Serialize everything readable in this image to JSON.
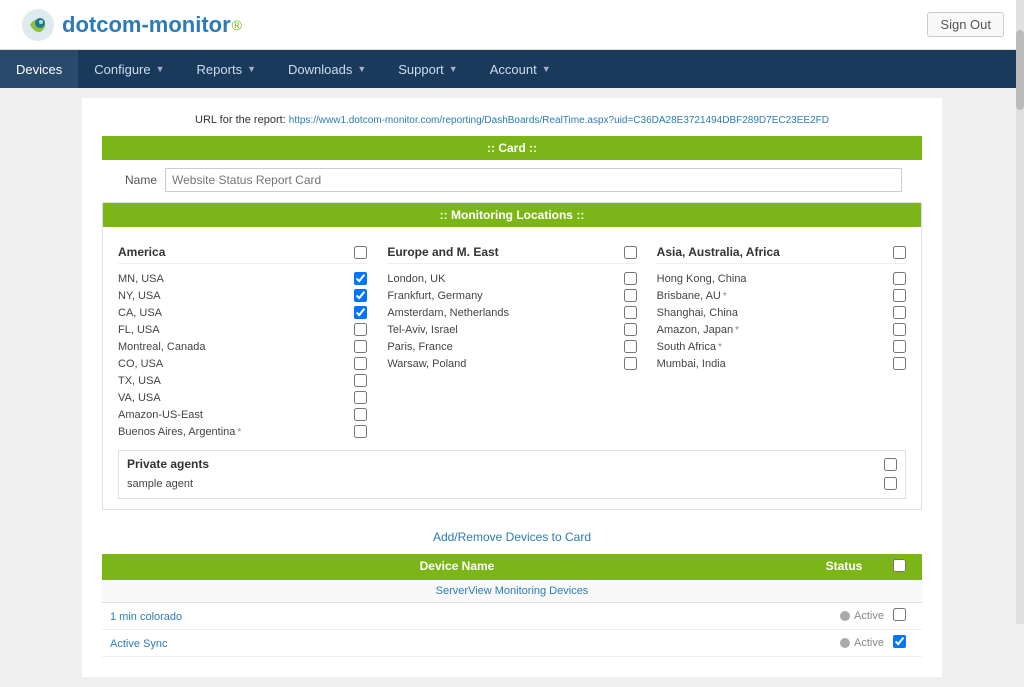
{
  "logo": {
    "text": "dotcom-monitor",
    "alt": "Dotcom-Monitor logo"
  },
  "topbar": {
    "signout_label": "Sign Out"
  },
  "nav": {
    "items": [
      {
        "id": "devices",
        "label": "Devices",
        "has_arrow": false,
        "active": true
      },
      {
        "id": "configure",
        "label": "Configure",
        "has_arrow": true
      },
      {
        "id": "reports",
        "label": "Reports",
        "has_arrow": true
      },
      {
        "id": "downloads",
        "label": "Downloads",
        "has_arrow": true
      },
      {
        "id": "support",
        "label": "Support",
        "has_arrow": true
      },
      {
        "id": "account",
        "label": "Account",
        "has_arrow": true
      }
    ]
  },
  "url_row": {
    "prefix": "URL for the report:",
    "url": "https://www1.dotcom-monitor.com/reporting/DashBoards/RealTime.aspx?uid=C36DA28E3721494DBF289D7EC23EE2FD"
  },
  "card_section": {
    "header": ":: Card ::",
    "name_label": "Name",
    "name_placeholder": "Website Status Report Card"
  },
  "monitoring": {
    "header": ":: Monitoring Locations ::",
    "columns": [
      {
        "id": "america",
        "title": "America",
        "locations": [
          {
            "name": "MN, USA",
            "checked": true,
            "asterisk": false
          },
          {
            "name": "NY, USA",
            "checked": true,
            "asterisk": false
          },
          {
            "name": "CA, USA",
            "checked": true,
            "asterisk": false
          },
          {
            "name": "FL, USA",
            "checked": false,
            "asterisk": false
          },
          {
            "name": "Montreal, Canada",
            "checked": false,
            "asterisk": false
          },
          {
            "name": "CO, USA",
            "checked": false,
            "asterisk": false
          },
          {
            "name": "TX, USA",
            "checked": false,
            "asterisk": false
          },
          {
            "name": "VA, USA",
            "checked": false,
            "asterisk": false
          },
          {
            "name": "Amazon-US-East",
            "checked": false,
            "asterisk": false
          },
          {
            "name": "Buenos Aires, Argentina",
            "checked": false,
            "asterisk": true
          }
        ]
      },
      {
        "id": "europe",
        "title": "Europe and M. East",
        "locations": [
          {
            "name": "London, UK",
            "checked": false,
            "asterisk": false
          },
          {
            "name": "Frankfurt, Germany",
            "checked": false,
            "asterisk": false
          },
          {
            "name": "Amsterdam, Netherlands",
            "checked": false,
            "asterisk": false
          },
          {
            "name": "Tel-Aviv, Israel",
            "checked": false,
            "asterisk": false
          },
          {
            "name": "Paris, France",
            "checked": false,
            "asterisk": false
          },
          {
            "name": "Warsaw, Poland",
            "checked": false,
            "asterisk": false
          }
        ]
      },
      {
        "id": "asia",
        "title": "Asia, Australia, Africa",
        "locations": [
          {
            "name": "Hong Kong, China",
            "checked": false,
            "asterisk": false
          },
          {
            "name": "Brisbane, AU",
            "checked": false,
            "asterisk": true
          },
          {
            "name": "Shanghai, China",
            "checked": false,
            "asterisk": false
          },
          {
            "name": "Amazon, Japan",
            "checked": false,
            "asterisk": true
          },
          {
            "name": "South Africa",
            "checked": false,
            "asterisk": true
          },
          {
            "name": "Mumbai, India",
            "checked": false,
            "asterisk": false
          }
        ]
      }
    ]
  },
  "private_agents": {
    "title": "Private agents",
    "agents": [
      {
        "name": "sample agent",
        "checked": false
      }
    ]
  },
  "add_remove": {
    "label": "Add/Remove Devices to Card"
  },
  "device_table": {
    "col_name": "Device Name",
    "col_status": "Status",
    "serverview_label": "ServerView Monitoring Devices",
    "devices": [
      {
        "name": "1 min colorado",
        "status": "Active",
        "checked": false
      },
      {
        "name": "Active Sync",
        "status": "Active",
        "checked": true
      }
    ]
  }
}
